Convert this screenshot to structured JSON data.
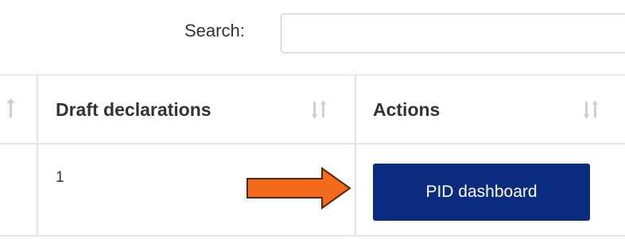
{
  "search": {
    "label": "Search:",
    "value": "",
    "placeholder": ""
  },
  "table": {
    "columns": [
      {
        "label": "",
        "icon": "sort-icon"
      },
      {
        "label": "Draft declarations",
        "icon": "sort-icon"
      },
      {
        "label": "Actions",
        "icon": "sort-icon"
      }
    ],
    "rows": [
      {
        "draft_declarations": "1",
        "action_label": "PID dashboard"
      }
    ]
  },
  "annotation": {
    "icon": "right-arrow-icon",
    "color": "#f26b1d"
  },
  "colors": {
    "button": "#0b2b7f",
    "button_text": "#ffffff",
    "text": "#333333",
    "sort_icon": "#cfcfcf",
    "border": "#dddddd"
  }
}
